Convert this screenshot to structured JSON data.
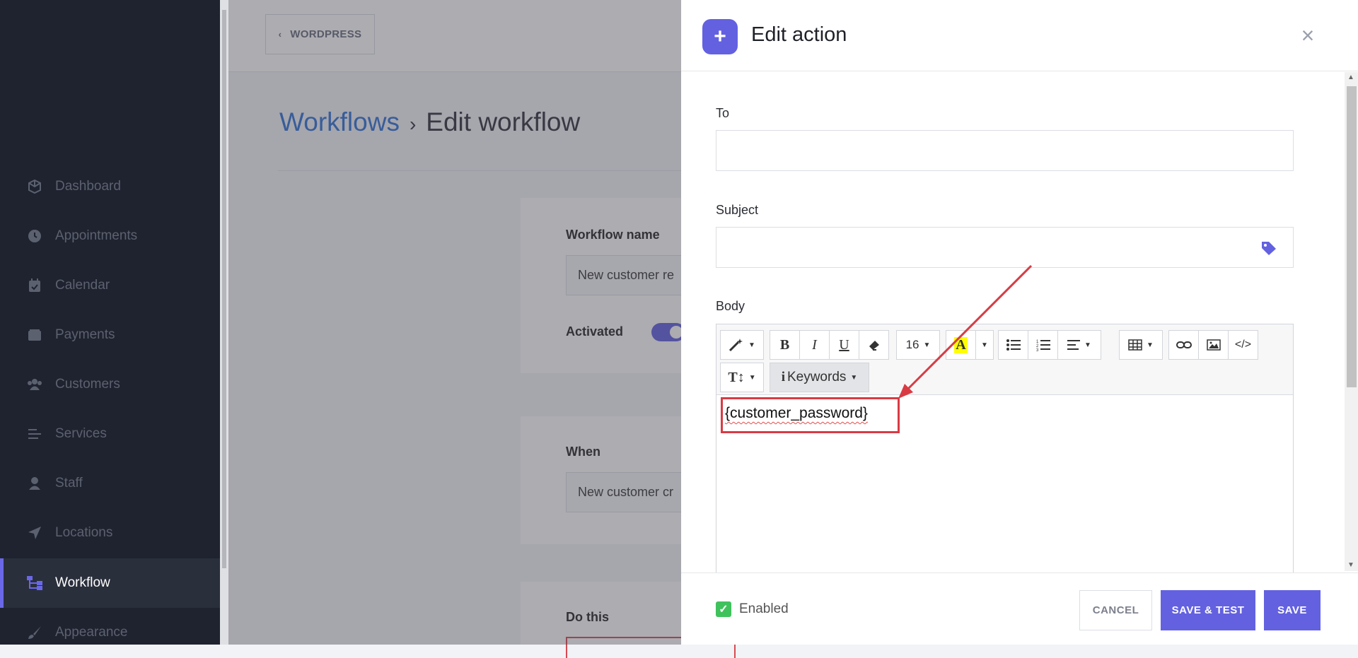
{
  "sidebar": {
    "items": [
      {
        "label": "Dashboard",
        "icon": "cube-icon"
      },
      {
        "label": "Appointments",
        "icon": "clock-icon"
      },
      {
        "label": "Calendar",
        "icon": "calendar-icon"
      },
      {
        "label": "Payments",
        "icon": "wallet-icon"
      },
      {
        "label": "Customers",
        "icon": "users-icon"
      },
      {
        "label": "Services",
        "icon": "list-icon"
      },
      {
        "label": "Staff",
        "icon": "user-icon"
      },
      {
        "label": "Locations",
        "icon": "location-arrow-icon"
      },
      {
        "label": "Workflow",
        "icon": "workflow-icon",
        "active": true
      },
      {
        "label": "Appearance",
        "icon": "brush-icon"
      }
    ]
  },
  "topbar": {
    "back_label": "WORDPRESS"
  },
  "page": {
    "breadcrumb_link": "Workflows",
    "breadcrumb_sep": "›",
    "title": "Edit workflow"
  },
  "workflow_card": {
    "name_label": "Workflow name",
    "name_value": "New customer re",
    "activated_label": "Activated",
    "activated": true
  },
  "when_card": {
    "label": "When",
    "value": "New customer cr"
  },
  "do_card": {
    "label": "Do this"
  },
  "panel": {
    "title": "Edit action",
    "plus": "+",
    "close": "×",
    "to_label": "To",
    "to_value": "",
    "subject_label": "Subject",
    "subject_value": "",
    "body_label": "Body",
    "body_content": "{customer_password}",
    "toolbar": {
      "font_size": "16",
      "keywords_label": "Keywords",
      "code_label": "</>"
    },
    "enabled_label": "Enabled",
    "enabled": true,
    "cancel_label": "CANCEL",
    "save_test_label": "SAVE & TEST",
    "save_label": "SAVE"
  },
  "colors": {
    "accent": "#6361e0",
    "sidebar_bg": "#1f2330",
    "link": "#2d6fd3",
    "annotation_red": "#d83b44",
    "check_green": "#3fc25c"
  }
}
